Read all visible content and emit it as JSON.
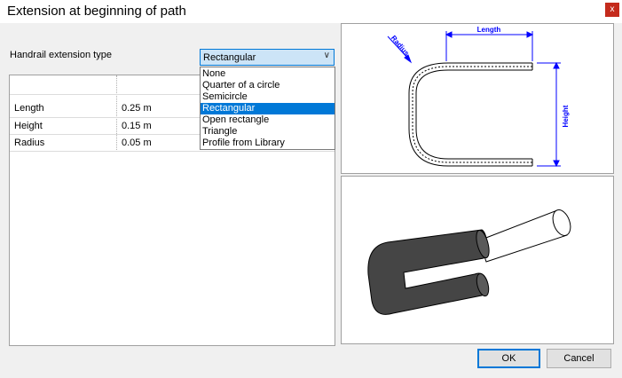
{
  "window": {
    "title": "Extension at beginning of path",
    "close_label": "x"
  },
  "form": {
    "type_label": "Handrail extension type",
    "type_selected": "Rectangular",
    "type_options": [
      "None",
      "Quarter of a circle",
      "Semicircle",
      "Rectangular",
      "Open rectangle",
      "Triangle",
      "Profile from Library"
    ],
    "type_selected_index": 3
  },
  "properties": [
    {
      "name": "Length",
      "value": "0.25 m"
    },
    {
      "name": "Height",
      "value": "0.15 m"
    },
    {
      "name": "Radius",
      "value": "0.05 m"
    }
  ],
  "diagram": {
    "length_label": "Length",
    "height_label": "Height",
    "radius_label": "Radius",
    "dimension_color": "#0000ff"
  },
  "buttons": {
    "ok_label": "OK",
    "cancel_label": "Cancel"
  }
}
